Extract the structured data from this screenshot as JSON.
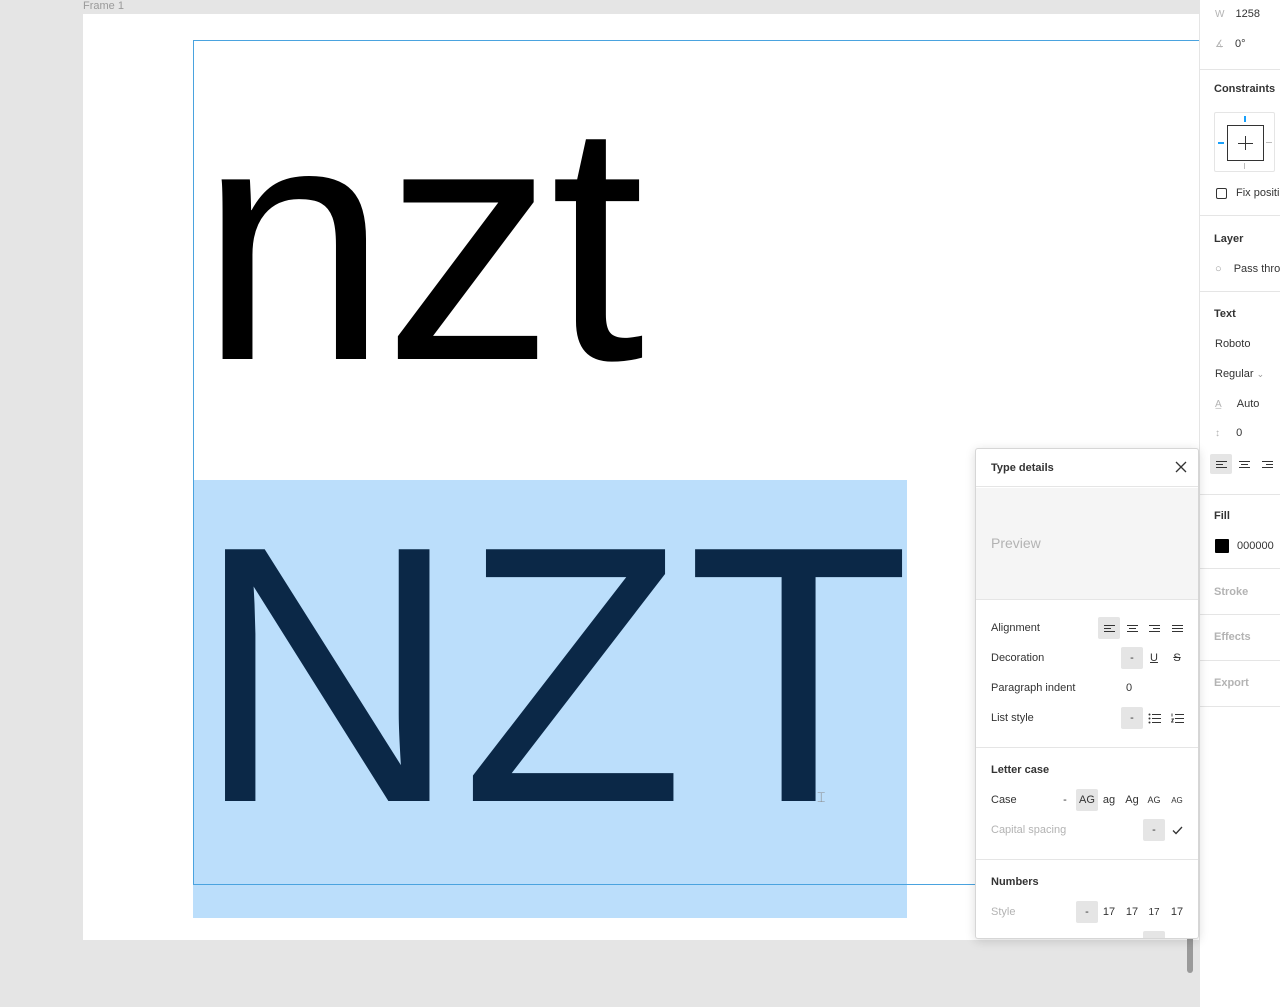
{
  "canvas": {
    "frame_label": "Frame 1",
    "lowercase_text": "nzt",
    "uppercase_text": "NZT"
  },
  "properties": {
    "width_label": "W",
    "width_value": "1258",
    "rotation_value": "0°",
    "constraints_title": "Constraints",
    "fix_position_label": "Fix positi",
    "layer_title": "Layer",
    "layer_blend": "Pass thro",
    "text_title": "Text",
    "font_family": "Roboto",
    "font_weight": "Regular",
    "line_height": "Auto",
    "letter_spacing": "0",
    "fill_title": "Fill",
    "fill_hex": "000000",
    "stroke_title": "Stroke",
    "effects_title": "Effects",
    "export_title": "Export",
    "colors": {
      "accent": "#18a0fb",
      "selection": "#bbdefb",
      "text_dark": "#0b2847"
    }
  },
  "type_details": {
    "title": "Type details",
    "preview": "Preview",
    "alignment_label": "Alignment",
    "decoration_label": "Decoration",
    "decoration_none": "-",
    "paragraph_indent_label": "Paragraph indent",
    "paragraph_indent_value": "0",
    "list_style_label": "List style",
    "list_none": "-",
    "letter_case_title": "Letter case",
    "case_label": "Case",
    "case_options": [
      "-",
      "AG",
      "ag",
      "Ag",
      "AG",
      "AG"
    ],
    "capital_spacing_label": "Capital spacing",
    "capital_spacing_none": "-",
    "numbers_title": "Numbers",
    "style_label": "Style",
    "number_style_options": [
      "-",
      "17",
      "17",
      "17",
      "17"
    ]
  }
}
